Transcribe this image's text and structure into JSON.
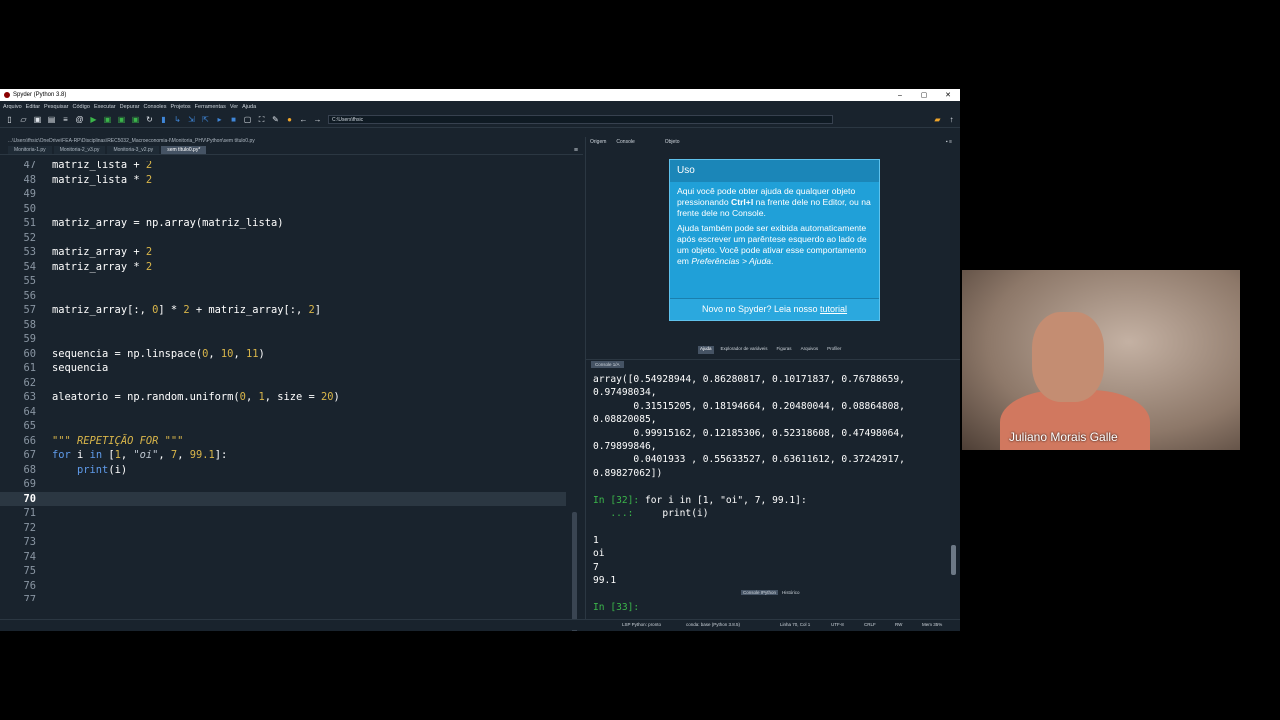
{
  "window": {
    "title": "Spyder (Python 3.8)",
    "minimize": "–",
    "maximize": "▢",
    "close": "✕"
  },
  "menu": [
    "Arquivo",
    "Editar",
    "Pesquisar",
    "Código",
    "Executar",
    "Depurar",
    "Consoles",
    "Projetos",
    "Ferramentas",
    "Ver",
    "Ajuda"
  ],
  "toolbar": {
    "path": "C:\\Users\\fhsic"
  },
  "editor": {
    "path": "...\\Users\\fhsic\\OneDrive\\FEA-RP\\Disciplinas\\REC5032_Macroeconomia-I\\Monitoria_PHV\\Python\\sem título0.py",
    "tabs": [
      "Monitoria-1.py",
      "Monitoria-2_v3.py",
      "Monitoria-3_v2.py",
      "sem título0.py*"
    ],
    "active_tab": 3,
    "lines": [
      {
        "n": "47",
        "t": "matriz_lista + 2"
      },
      {
        "n": "48",
        "t": "matriz_lista * 2"
      },
      {
        "n": "49",
        "t": ""
      },
      {
        "n": "50",
        "t": ""
      },
      {
        "n": "51",
        "t": "matriz_array = np.array(matriz_lista)"
      },
      {
        "n": "52",
        "t": ""
      },
      {
        "n": "53",
        "t": "matriz_array + 2"
      },
      {
        "n": "54",
        "t": "matriz_array * 2"
      },
      {
        "n": "55",
        "t": ""
      },
      {
        "n": "56",
        "t": ""
      },
      {
        "n": "57",
        "t": "matriz_array[:, 0] * 2 + matriz_array[:, 2]"
      },
      {
        "n": "58",
        "t": ""
      },
      {
        "n": "59",
        "t": ""
      },
      {
        "n": "60",
        "t": "sequencia = np.linspace(0, 10, 11)"
      },
      {
        "n": "61",
        "t": "sequencia"
      },
      {
        "n": "62",
        "t": ""
      },
      {
        "n": "63",
        "t": "aleatorio = np.random.uniform(0, 1, size = 20)"
      },
      {
        "n": "64",
        "t": ""
      },
      {
        "n": "65",
        "t": ""
      },
      {
        "n": "66",
        "t": "\"\"\" REPETIÇÃO FOR \"\"\""
      },
      {
        "n": "67",
        "t": "for i in [1, \"oi\", 7, 99.1]:"
      },
      {
        "n": "68",
        "t": "    print(i)"
      },
      {
        "n": "69",
        "t": ""
      },
      {
        "n": "70",
        "t": ""
      },
      {
        "n": "71",
        "t": ""
      },
      {
        "n": "72",
        "t": ""
      },
      {
        "n": "73",
        "t": ""
      },
      {
        "n": "74",
        "t": ""
      },
      {
        "n": "75",
        "t": ""
      },
      {
        "n": "76",
        "t": ""
      },
      {
        "n": "77",
        "t": ""
      }
    ],
    "current_line": "70"
  },
  "help": {
    "tabs": [
      "Origem",
      "Console",
      "Objeto"
    ],
    "title": "Uso",
    "p1_a": "Aqui você pode obter ajuda de qualquer objeto pressionando ",
    "p1_b": "Ctrl+I",
    "p1_c": " na frente dele no Editor, ou na frente dele no Console.",
    "p2_a": "Ajuda também pode ser exibida automaticamente após escrever um parêntese esquerdo ao lado de um objeto. Você pode ativar esse comportamento em ",
    "p2_b": "Preferências > Ajuda",
    "p2_c": ".",
    "foot_a": "Novo no Spyder? Leia nosso ",
    "foot_link": "tutorial",
    "bottom_tabs": [
      "Ajuda",
      "Explorador de variáveis",
      "Figuras",
      "Arquivos",
      "Profiler"
    ]
  },
  "console": {
    "tab": "Console 1/A",
    "output": [
      "array([0.54928944, 0.86280817, 0.10171837, 0.76788659,",
      "0.97498034,",
      "       0.31515205, 0.18194664, 0.20480044, 0.08864808,",
      "0.08820085,",
      "       0.99915162, 0.12185306, 0.52318608, 0.47498064,",
      "0.79899846,",
      "       0.0401933 , 0.55633527, 0.63611612, 0.37242917,",
      "0.89827062])"
    ],
    "prompt32": "In [32]:",
    "cmd1": " for i in [1, \"oi\", 7, 99.1]:",
    "cont": "   ...:",
    "cmd2": "     print(i)",
    "results": [
      "1",
      "oi",
      "7",
      "99.1"
    ],
    "prompt33": "In [33]:",
    "bottom_tabs": [
      "Console IPython",
      "Histórico"
    ]
  },
  "status": {
    "lsp": "LSP Python: pronto",
    "conda": "conda: base (Python 3.8.5)",
    "pos": "Linha 70, Col 1",
    "enc": "UTF-8",
    "eol": "CRLF",
    "rw": "RW",
    "mem": "Mem 35%"
  },
  "webcam": {
    "name": "Juliano Morais Galle"
  }
}
